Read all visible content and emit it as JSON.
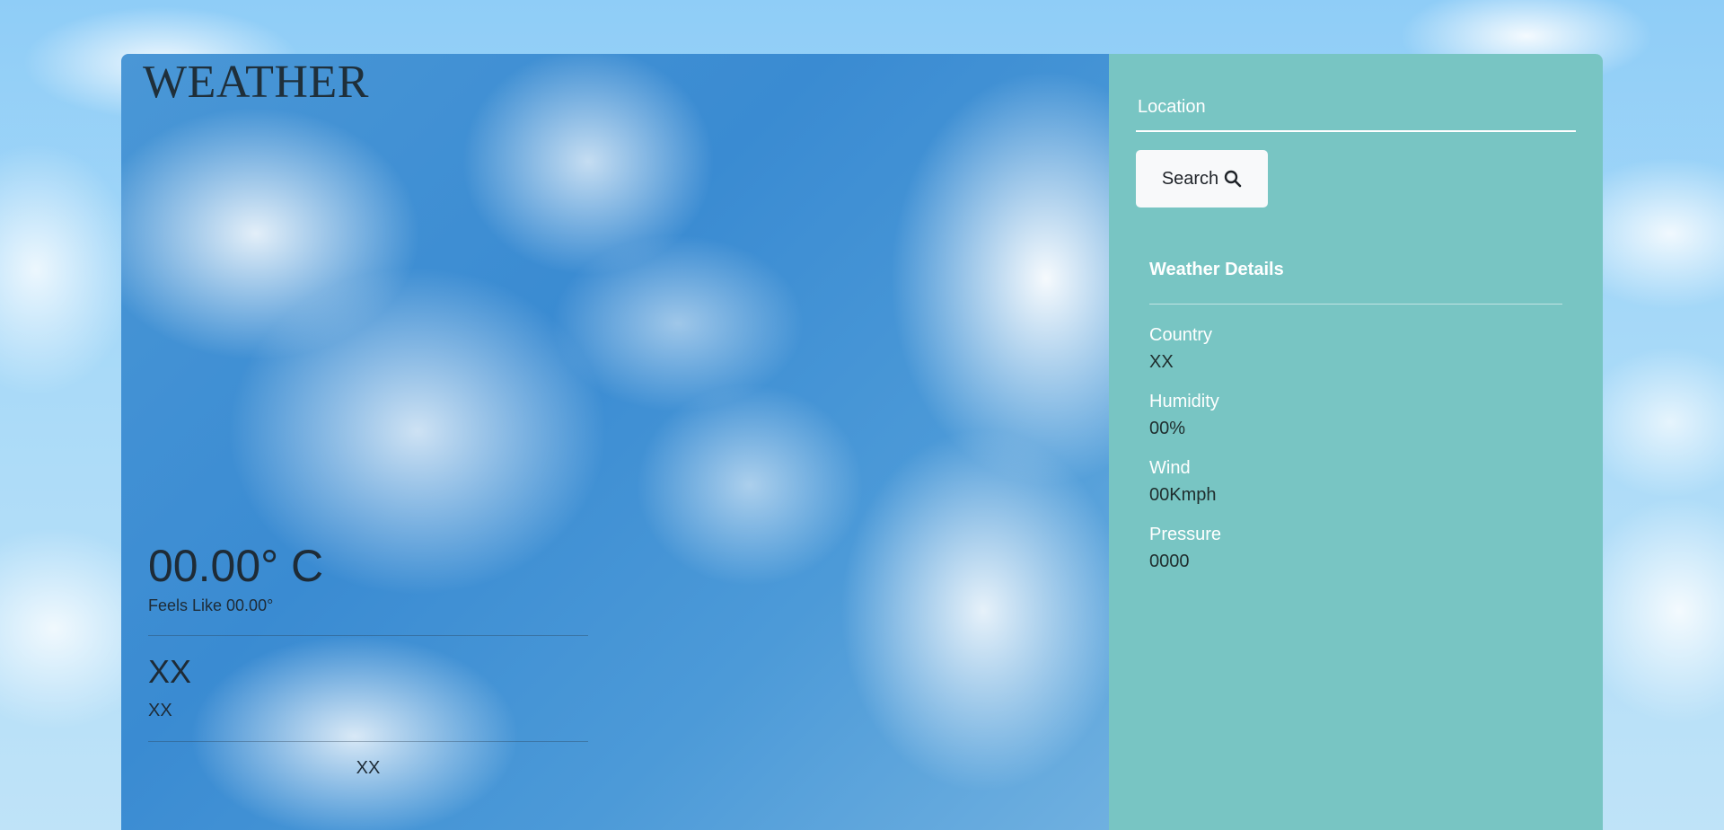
{
  "app": {
    "title": "WEATHER"
  },
  "current": {
    "temperature": "00.00° C",
    "feels_like": "Feels Like 00.00°",
    "location": "XX",
    "description": "XX",
    "footer": "XX"
  },
  "search": {
    "placeholder": "Location",
    "button_label": "Search",
    "button_icon": "search-icon"
  },
  "details": {
    "title": "Weather Details",
    "items": [
      {
        "label": "Country",
        "value": "XX"
      },
      {
        "label": "Humidity",
        "value": "00%"
      },
      {
        "label": "Wind",
        "value": "00Kmph"
      },
      {
        "label": "Pressure",
        "value": "0000"
      }
    ]
  },
  "colors": {
    "side_panel": "#78c5c3",
    "button_bg": "#f8f9fa",
    "sky": "#3a8bd2"
  }
}
